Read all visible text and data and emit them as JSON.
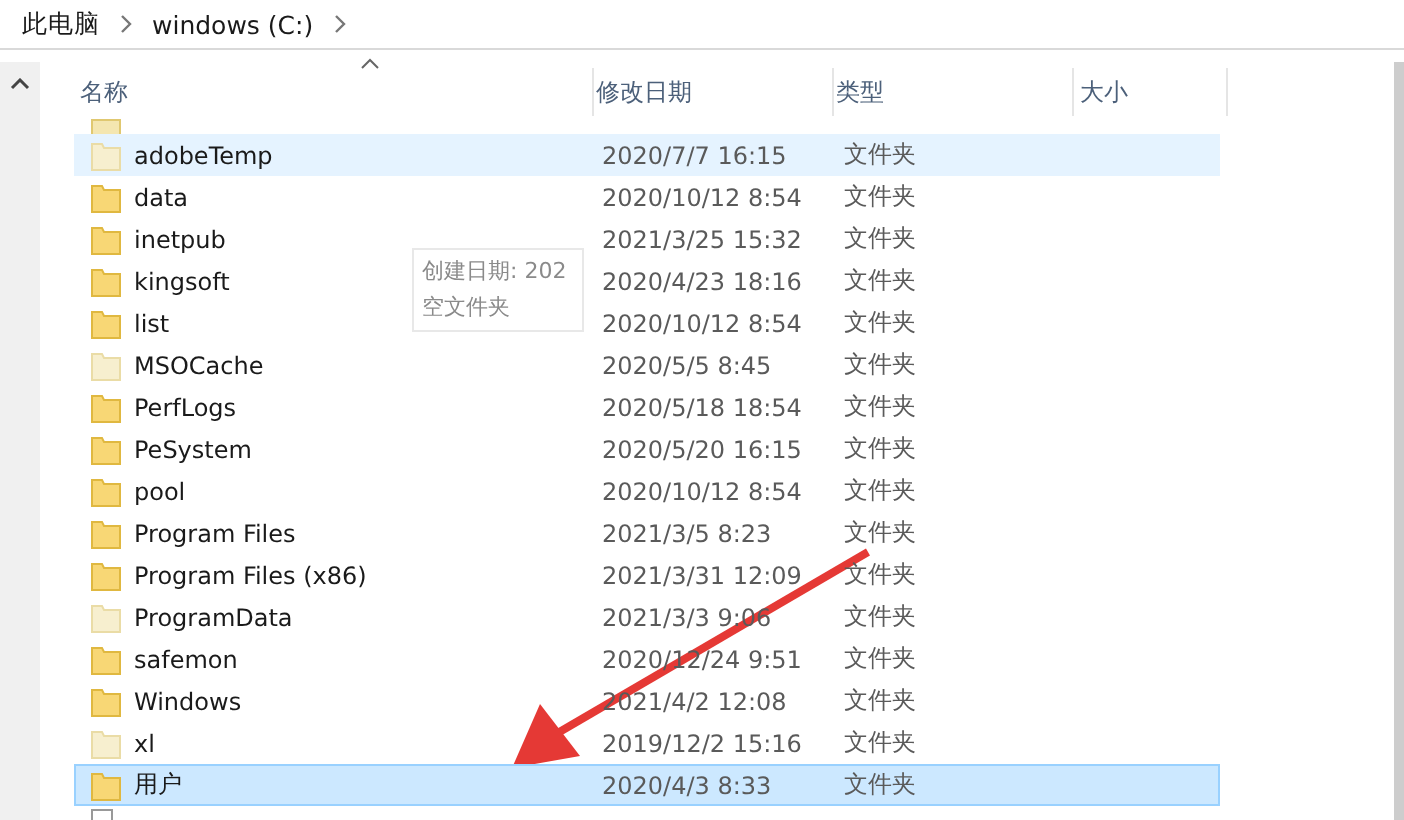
{
  "breadcrumb": [
    "此电脑",
    "windows (C:)"
  ],
  "columns": [
    "名称",
    "修改日期",
    "类型",
    "大小"
  ],
  "rows": [
    {
      "name": "adobeTemp",
      "date": "2020/7/7 16:15",
      "type": "文件夹",
      "hidden": true,
      "hovered": true,
      "selected": false
    },
    {
      "name": "data",
      "date": "2020/10/12 8:54",
      "type": "文件夹",
      "hidden": false,
      "hovered": false,
      "selected": false
    },
    {
      "name": "inetpub",
      "date": "2021/3/25 15:32",
      "type": "文件夹",
      "hidden": false,
      "hovered": false,
      "selected": false
    },
    {
      "name": "kingsoft",
      "date": "2020/4/23 18:16",
      "type": "文件夹",
      "hidden": false,
      "hovered": false,
      "selected": false
    },
    {
      "name": "list",
      "date": "2020/10/12 8:54",
      "type": "文件夹",
      "hidden": false,
      "hovered": false,
      "selected": false
    },
    {
      "name": "MSOCache",
      "date": "2020/5/5 8:45",
      "type": "文件夹",
      "hidden": true,
      "hovered": false,
      "selected": false
    },
    {
      "name": "PerfLogs",
      "date": "2020/5/18 18:54",
      "type": "文件夹",
      "hidden": false,
      "hovered": false,
      "selected": false
    },
    {
      "name": "PeSystem",
      "date": "2020/5/20 16:15",
      "type": "文件夹",
      "hidden": false,
      "hovered": false,
      "selected": false
    },
    {
      "name": "pool",
      "date": "2020/10/12 8:54",
      "type": "文件夹",
      "hidden": false,
      "hovered": false,
      "selected": false
    },
    {
      "name": "Program Files",
      "date": "2021/3/5 8:23",
      "type": "文件夹",
      "hidden": false,
      "hovered": false,
      "selected": false
    },
    {
      "name": "Program Files (x86)",
      "date": "2021/3/31 12:09",
      "type": "文件夹",
      "hidden": false,
      "hovered": false,
      "selected": false
    },
    {
      "name": "ProgramData",
      "date": "2021/3/3 9:06",
      "type": "文件夹",
      "hidden": true,
      "hovered": false,
      "selected": false
    },
    {
      "name": "safemon",
      "date": "2020/12/24 9:51",
      "type": "文件夹",
      "hidden": false,
      "hovered": false,
      "selected": false
    },
    {
      "name": "Windows",
      "date": "2021/4/2 12:08",
      "type": "文件夹",
      "hidden": false,
      "hovered": false,
      "selected": false
    },
    {
      "name": "xl",
      "date": "2019/12/2 15:16",
      "type": "文件夹",
      "hidden": true,
      "hovered": false,
      "selected": false
    },
    {
      "name": "用户",
      "date": "2020/4/3 8:33",
      "type": "文件夹",
      "hidden": false,
      "hovered": false,
      "selected": true
    }
  ],
  "tooltip": [
    "创建日期: 202",
    "空文件夹"
  ]
}
